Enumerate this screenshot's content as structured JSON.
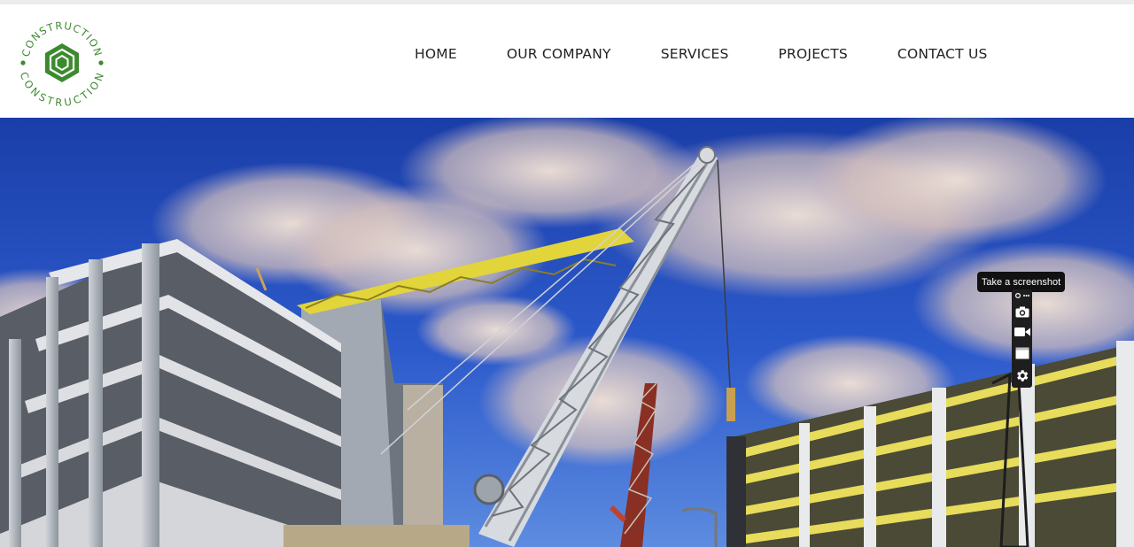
{
  "logo": {
    "text_top": "CONSTRUCTION",
    "text_bottom": "CONSTRUCTION",
    "color": "#3c8a2e"
  },
  "nav": {
    "items": [
      {
        "label": "HOME"
      },
      {
        "label": "OUR COMPANY"
      },
      {
        "label": "SERVICES"
      },
      {
        "label": "PROJECTS"
      },
      {
        "label": "CONTACT US"
      }
    ]
  },
  "hero": {
    "sky_color": "#1c43b5",
    "crane_color": "#e2d43b"
  },
  "screenshot_tool": {
    "tooltip": "Take a screenshot",
    "icons": [
      "grip-icon",
      "camera-icon",
      "video-icon",
      "window-icon",
      "gear-icon"
    ]
  }
}
